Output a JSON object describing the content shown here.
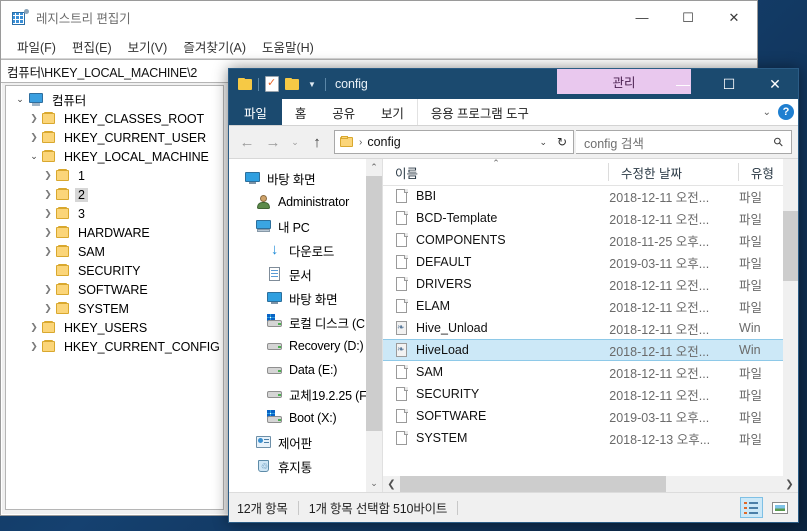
{
  "desktop": {
    "background_color": "#12406e"
  },
  "regedit": {
    "title": "레지스트리 편집기",
    "icon": "registry-editor-icon",
    "window_buttons": {
      "minimize": "—",
      "maximize": "☐",
      "close": "✕"
    },
    "menu": [
      {
        "label": "파일(F)"
      },
      {
        "label": "편집(E)"
      },
      {
        "label": "보기(V)"
      },
      {
        "label": "즐겨찾기(A)"
      },
      {
        "label": "도움말(H)"
      }
    ],
    "path": "컴퓨터\\HKEY_LOCAL_MACHINE\\2",
    "tree": [
      {
        "label": "컴퓨터",
        "indent": 0,
        "chevron": "open",
        "icon": "computer-icon",
        "selected": false
      },
      {
        "label": "HKEY_CLASSES_ROOT",
        "indent": 1,
        "chevron": "closed",
        "icon": "folder-icon",
        "selected": false
      },
      {
        "label": "HKEY_CURRENT_USER",
        "indent": 1,
        "chevron": "closed",
        "icon": "folder-icon",
        "selected": false
      },
      {
        "label": "HKEY_LOCAL_MACHINE",
        "indent": 1,
        "chevron": "open",
        "icon": "folder-icon",
        "selected": false
      },
      {
        "label": "1",
        "indent": 2,
        "chevron": "closed",
        "icon": "folder-icon",
        "selected": false
      },
      {
        "label": "2",
        "indent": 2,
        "chevron": "closed",
        "icon": "folder-icon",
        "selected": true
      },
      {
        "label": "3",
        "indent": 2,
        "chevron": "closed",
        "icon": "folder-icon",
        "selected": false
      },
      {
        "label": "HARDWARE",
        "indent": 2,
        "chevron": "closed",
        "icon": "folder-icon",
        "selected": false
      },
      {
        "label": "SAM",
        "indent": 2,
        "chevron": "closed",
        "icon": "folder-icon",
        "selected": false
      },
      {
        "label": "SECURITY",
        "indent": 2,
        "chevron": "none",
        "icon": "folder-icon",
        "selected": false
      },
      {
        "label": "SOFTWARE",
        "indent": 2,
        "chevron": "closed",
        "icon": "folder-icon",
        "selected": false
      },
      {
        "label": "SYSTEM",
        "indent": 2,
        "chevron": "closed",
        "icon": "folder-icon",
        "selected": false
      },
      {
        "label": "HKEY_USERS",
        "indent": 1,
        "chevron": "closed",
        "icon": "folder-icon",
        "selected": false
      },
      {
        "label": "HKEY_CURRENT_CONFIG",
        "indent": 1,
        "chevron": "closed",
        "icon": "folder-icon",
        "selected": false
      }
    ]
  },
  "explorer": {
    "title": "config",
    "contextual_tab_group": "관리",
    "quick_access": [
      {
        "icon": "folder-icon",
        "name": "save-icon"
      },
      {
        "icon": "properties-icon",
        "name": "properties-icon"
      },
      {
        "icon": "new-folder-icon",
        "name": "new-folder-icon"
      },
      {
        "icon": "chevron-down-icon",
        "name": "customize-qat-icon"
      }
    ],
    "window_buttons": {
      "minimize": "—",
      "maximize": "☐",
      "close": "✕"
    },
    "ribbon_tabs": [
      {
        "label": "파일",
        "active": false,
        "kind": "file"
      },
      {
        "label": "홈",
        "active": false,
        "kind": "normal"
      },
      {
        "label": "공유",
        "active": false,
        "kind": "normal"
      },
      {
        "label": "보기",
        "active": false,
        "kind": "normal"
      },
      {
        "label": "응용 프로그램 도구",
        "active": true,
        "kind": "contextual"
      }
    ],
    "ribbon_help": "?",
    "address": {
      "back": "←",
      "forward": "→",
      "recent": "⌄",
      "up": "↑",
      "breadcrumb": "config",
      "breadcrumb_separator": "›",
      "dropdown": "⌄",
      "refresh": "↻"
    },
    "search": {
      "placeholder": "config 검색",
      "icon": "search-icon"
    },
    "nav_pane": [
      {
        "label": "바탕 화면",
        "indent": 1,
        "icon": "desktop-icon"
      },
      {
        "label": "Administrator",
        "indent": 2,
        "icon": "user-icon"
      },
      {
        "label": "내 PC",
        "indent": 2,
        "icon": "this-pc-icon"
      },
      {
        "label": "다운로드",
        "indent": 3,
        "icon": "downloads-icon"
      },
      {
        "label": "문서",
        "indent": 3,
        "icon": "documents-icon"
      },
      {
        "label": "바탕 화면",
        "indent": 3,
        "icon": "desktop-icon"
      },
      {
        "label": "로컬 디스크 (C",
        "indent": 3,
        "icon": "system-drive-icon"
      },
      {
        "label": "Recovery (D:)",
        "indent": 3,
        "icon": "drive-icon"
      },
      {
        "label": "Data (E:)",
        "indent": 3,
        "icon": "drive-icon"
      },
      {
        "label": "교체19.2.25 (F",
        "indent": 3,
        "icon": "drive-icon"
      },
      {
        "label": "Boot (X:)",
        "indent": 3,
        "icon": "system-drive-icon"
      },
      {
        "label": "제어판",
        "indent": 2,
        "icon": "control-panel-icon"
      },
      {
        "label": "휴지통",
        "indent": 2,
        "icon": "recycle-bin-icon"
      }
    ],
    "columns": [
      {
        "label": "이름",
        "sorted": true,
        "sort_caret": "⌃"
      },
      {
        "label": "수정한 날짜",
        "sorted": false
      },
      {
        "label": "유형",
        "sorted": false
      }
    ],
    "files": [
      {
        "name": "BBI",
        "modified": "2018-12-11 오전...",
        "type": "파일",
        "icon": "file-icon",
        "selected": false
      },
      {
        "name": "BCD-Template",
        "modified": "2018-12-11 오전...",
        "type": "파일",
        "icon": "file-icon",
        "selected": false
      },
      {
        "name": "COMPONENTS",
        "modified": "2018-11-25 오후...",
        "type": "파일",
        "icon": "file-icon",
        "selected": false
      },
      {
        "name": "DEFAULT",
        "modified": "2019-03-11 오후...",
        "type": "파일",
        "icon": "file-icon",
        "selected": false
      },
      {
        "name": "DRIVERS",
        "modified": "2018-12-11 오전...",
        "type": "파일",
        "icon": "file-icon",
        "selected": false
      },
      {
        "name": "ELAM",
        "modified": "2018-12-11 오전...",
        "type": "파일",
        "icon": "file-icon",
        "selected": false
      },
      {
        "name": "Hive_Unload",
        "modified": "2018-12-11 오전...",
        "type": "Win",
        "icon": "registry-file-icon",
        "selected": false
      },
      {
        "name": "HiveLoad",
        "modified": "2018-12-11 오전...",
        "type": "Win",
        "icon": "registry-file-icon",
        "selected": true
      },
      {
        "name": "SAM",
        "modified": "2018-12-11 오전...",
        "type": "파일",
        "icon": "file-icon",
        "selected": false
      },
      {
        "name": "SECURITY",
        "modified": "2018-12-11 오전...",
        "type": "파일",
        "icon": "file-icon",
        "selected": false
      },
      {
        "name": "SOFTWARE",
        "modified": "2019-03-11 오후...",
        "type": "파일",
        "icon": "file-icon",
        "selected": false
      },
      {
        "name": "SYSTEM",
        "modified": "2018-12-13 오후...",
        "type": "파일",
        "icon": "file-icon",
        "selected": false
      }
    ],
    "status": {
      "item_count": "12개 항목",
      "selection": "1개 항목 선택함 510바이트"
    },
    "view_buttons": [
      {
        "name": "details-view",
        "active": true
      },
      {
        "name": "large-icons-view",
        "active": false
      }
    ],
    "scroll": {
      "horizontal_arrow_left": "❮",
      "horizontal_arrow_right": "❯"
    }
  }
}
